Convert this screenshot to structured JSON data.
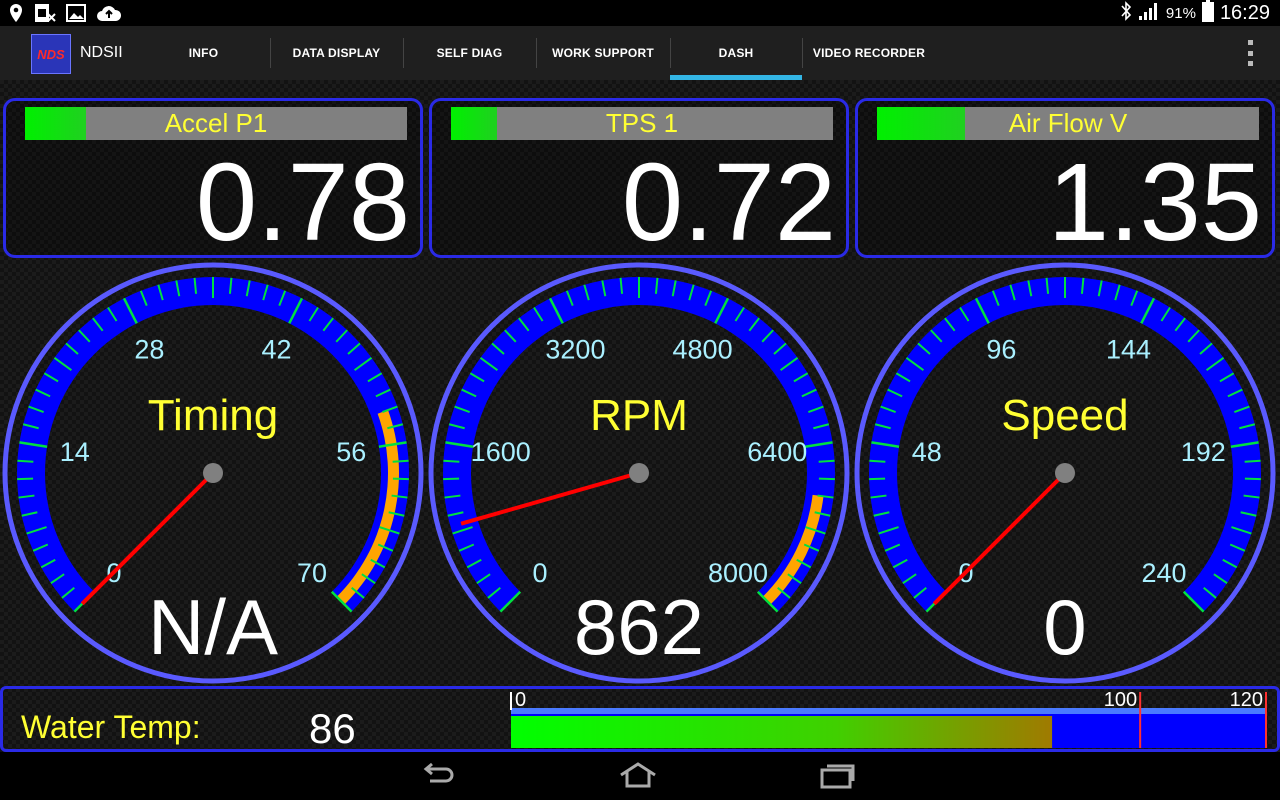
{
  "status": {
    "battery": "91%",
    "time": "16:29"
  },
  "app": {
    "name": "NDSII",
    "logo_text": "NDS"
  },
  "tabs": [
    {
      "label": "INFO"
    },
    {
      "label": "DATA DISPLAY"
    },
    {
      "label": "SELF DIAG"
    },
    {
      "label": "WORK SUPPORT"
    },
    {
      "label": "DASH",
      "active": true
    },
    {
      "label": "VIDEO RECORDER"
    }
  ],
  "readouts": [
    {
      "label": "Accel P1",
      "value": "0.78",
      "level": 0.16
    },
    {
      "label": "TPS 1",
      "value": "0.72",
      "level": 0.12
    },
    {
      "label": "Air Flow V",
      "value": "1.35",
      "level": 0.23
    }
  ],
  "gauges": [
    {
      "title": "Timing",
      "value": "N/A",
      "ticks": [
        "0",
        "14",
        "28",
        "42",
        "56",
        "70"
      ],
      "min": 0,
      "max": 70,
      "needle": 0,
      "warn_from": 0.76
    },
    {
      "title": "RPM",
      "value": "862",
      "ticks": [
        "0",
        "1600",
        "3200",
        "4800",
        "6400",
        "8000"
      ],
      "min": 0,
      "max": 8000,
      "needle": 862,
      "warn_from": 0.86
    },
    {
      "title": "Speed",
      "value": "0",
      "ticks": [
        "0",
        "48",
        "96",
        "144",
        "192",
        "240"
      ],
      "min": 0,
      "max": 240,
      "needle": 0,
      "warn_from": null
    }
  ],
  "water_temp": {
    "label": "Water Temp:",
    "value": "86",
    "scale_min": "0",
    "scale_mark": "100",
    "scale_max": "120",
    "min": 0,
    "max": 120,
    "current": 86,
    "limit": 100
  },
  "colors": {
    "accent": "#33b5e5",
    "frame": "#2a2ae6",
    "gauge_band": "#0000ff",
    "warn": "#ffa500",
    "needle": "#ff0000",
    "label_yellow": "#ffff33",
    "tick_green": "#00e040"
  }
}
